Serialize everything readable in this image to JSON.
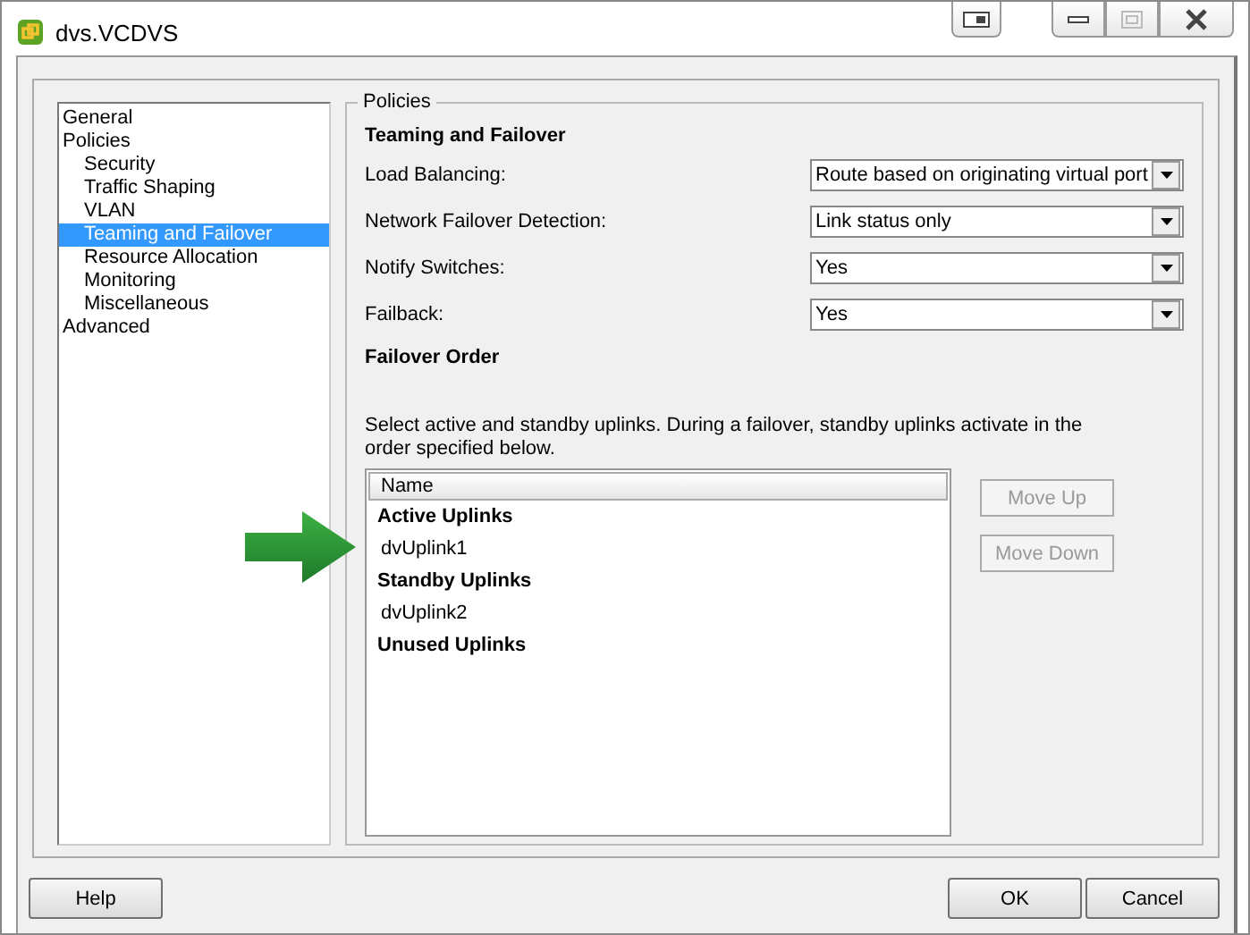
{
  "window": {
    "title": "dvs.VCDVS"
  },
  "sidebar": {
    "items": [
      {
        "label": "General",
        "selected": false
      },
      {
        "label": "Policies",
        "selected": false,
        "children": [
          {
            "label": "Security",
            "selected": false
          },
          {
            "label": "Traffic Shaping",
            "selected": false
          },
          {
            "label": "VLAN",
            "selected": false
          },
          {
            "label": "Teaming and Failover",
            "selected": true
          },
          {
            "label": "Resource Allocation",
            "selected": false
          },
          {
            "label": "Monitoring",
            "selected": false
          },
          {
            "label": "Miscellaneous",
            "selected": false
          }
        ]
      },
      {
        "label": "Advanced",
        "selected": false
      }
    ]
  },
  "policies": {
    "group_title": "Policies",
    "heading": "Teaming and Failover",
    "fields": [
      {
        "label": "Load Balancing:",
        "value": "Route based on originating virtual port"
      },
      {
        "label": "Network Failover Detection:",
        "value": "Link status only"
      },
      {
        "label": "Notify Switches:",
        "value": "Yes"
      },
      {
        "label": "Failback:",
        "value": "Yes"
      }
    ],
    "order_heading": "Failover Order",
    "description": "Select active and standby uplinks. During a failover, standby uplinks activate in the order specified below.",
    "table": {
      "columns": [
        "Name"
      ],
      "rows": [
        {
          "kind": "group",
          "label": "Active Uplinks"
        },
        {
          "kind": "uplink",
          "label": "dvUplink1"
        },
        {
          "kind": "group",
          "label": "Standby Uplinks"
        },
        {
          "kind": "uplink",
          "label": "dvUplink2"
        },
        {
          "kind": "group",
          "label": "Unused Uplinks"
        }
      ]
    },
    "buttons": [
      {
        "label": "Move Up",
        "disabled": true
      },
      {
        "label": "Move Down",
        "disabled": true
      }
    ]
  },
  "footer": {
    "buttons": [
      {
        "label": "Help"
      },
      {
        "label": "OK"
      },
      {
        "label": "Cancel"
      }
    ]
  }
}
